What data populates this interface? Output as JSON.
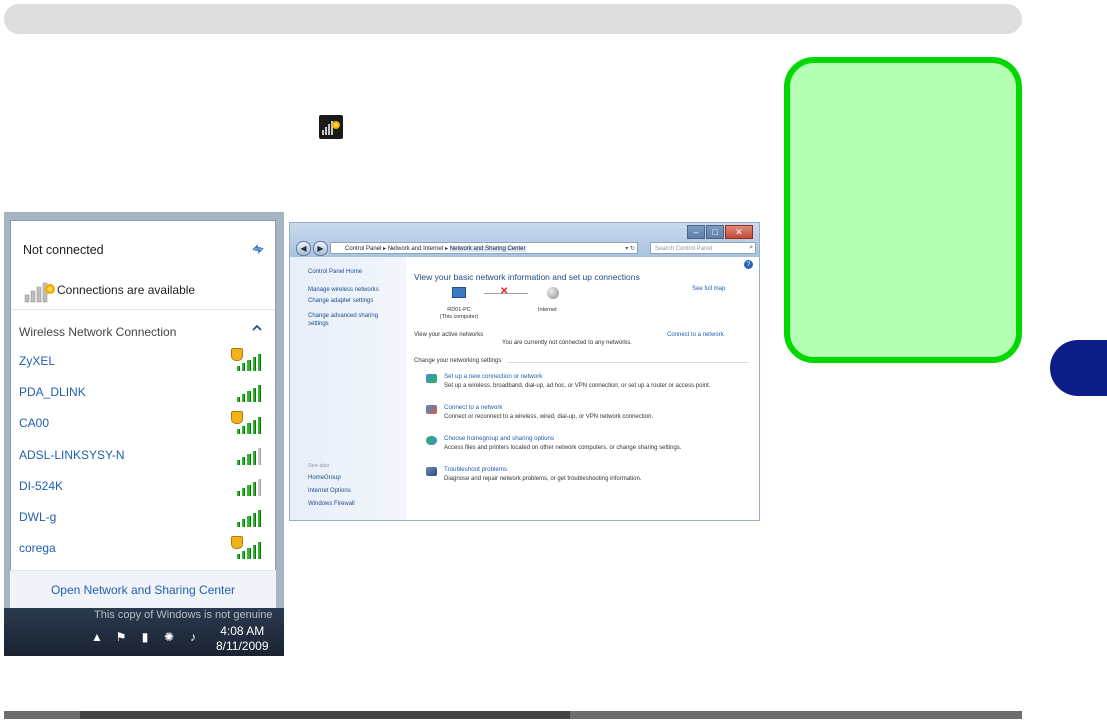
{
  "popup": {
    "status": "Not connected",
    "available": "Connections are available",
    "section_title": "Wireless Network Connection",
    "networks": [
      {
        "name": "ZyXEL",
        "secured": true,
        "bars": 5
      },
      {
        "name": "PDA_DLINK",
        "secured": false,
        "bars": 5
      },
      {
        "name": "CA00",
        "secured": true,
        "bars": 5
      },
      {
        "name": "ADSL-LINKSYSY-N",
        "secured": false,
        "bars": 4
      },
      {
        "name": "DI-524K",
        "secured": false,
        "bars": 4
      },
      {
        "name": "DWL-g",
        "secured": false,
        "bars": 5
      },
      {
        "name": "corega",
        "secured": true,
        "bars": 5
      }
    ],
    "footer_link": "Open Network and Sharing Center"
  },
  "taskbar": {
    "watermark": "This copy of Windows is not genuine",
    "time": "4:08 AM",
    "date": "8/11/2009"
  },
  "nsc": {
    "address": {
      "crumb1": "Control Panel",
      "crumb2": "Network and Internet",
      "crumb3": "Network and Sharing Center"
    },
    "search_placeholder": "Search Control Panel",
    "left": {
      "home": "Control Panel Home",
      "link1": "Manage wireless networks",
      "link2": "Change adapter settings",
      "link3": "Change advanced sharing settings",
      "see_also": "See also",
      "also1": "HomeGroup",
      "also2": "Internet Options",
      "also3": "Windows Firewall"
    },
    "title": "View your basic network information and set up connections",
    "see_full_map": "See full map",
    "pc_name": "RD01-PC",
    "pc_sub": "(This computer)",
    "internet": "Internet",
    "active_label": "View your active networks",
    "connect_link": "Connect to a network",
    "not_connected_msg": "You are currently not connected to any networks.",
    "change_label": "Change your networking settings",
    "tasks": [
      {
        "title": "Set up a new connection or network",
        "desc": "Set up a wireless, broadband, dial-up, ad hoc, or VPN connection; or set up a router or access point."
      },
      {
        "title": "Connect to a network",
        "desc": "Connect or reconnect to a wireless, wired, dial-up, or VPN network connection."
      },
      {
        "title": "Choose homegroup and sharing options",
        "desc": "Access files and printers located on other network computers, or change sharing settings."
      },
      {
        "title": "Troubleshoot problems",
        "desc": "Diagnose and repair network problems, or get troubleshooting information."
      }
    ]
  },
  "colors": {
    "callout_fill": "#b5ffb5",
    "callout_border": "#00d800",
    "tab_marker": "#0b1d86",
    "link": "#1f5fb0"
  }
}
